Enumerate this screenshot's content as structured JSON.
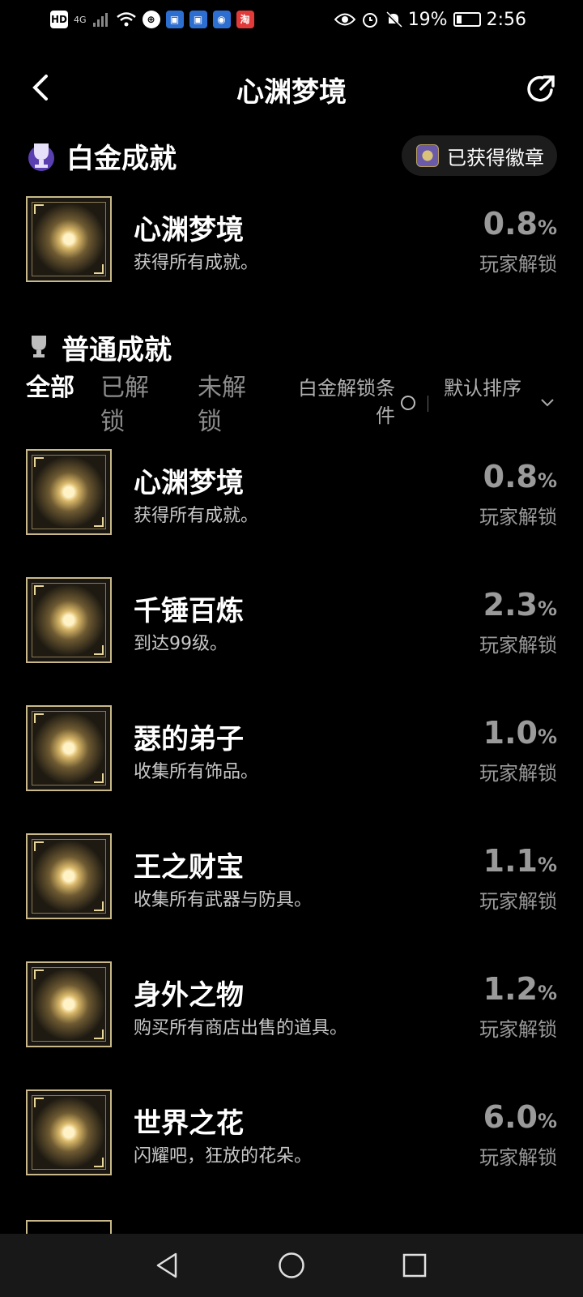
{
  "status_bar": {
    "hd": "HD",
    "network": "4G",
    "battery": "19%",
    "time": "2:56",
    "app_chip_taobao": "淘"
  },
  "header": {
    "title": "心渊梦境"
  },
  "platinum": {
    "title": "白金成就",
    "badge_label": "已获得徽章",
    "item": {
      "name": "心渊梦境",
      "desc": "获得所有成就。",
      "pct": "0.8",
      "unit": "%",
      "unlock": "玩家解锁"
    }
  },
  "normal": {
    "title": "普通成就"
  },
  "filters": {
    "tab_all": "全部",
    "tab_unlocked": "已解锁",
    "tab_locked": "未解锁",
    "platinum_condition": "白金解锁条件",
    "sort": "默认排序"
  },
  "achievements": [
    {
      "name": "心渊梦境",
      "desc": "获得所有成就。",
      "pct": "0.8",
      "unit": "%",
      "unlock": "玩家解锁",
      "icon": "dream-crest-icon"
    },
    {
      "name": "千锤百炼",
      "desc": "到达99级。",
      "pct": "2.3",
      "unit": "%",
      "unlock": "玩家解锁",
      "icon": "infinity-icon"
    },
    {
      "name": "瑟的弟子",
      "desc": "收集所有饰品。",
      "pct": "1.0",
      "unit": "%",
      "unlock": "玩家解锁",
      "icon": "creature-icon"
    },
    {
      "name": "王之财宝",
      "desc": "收集所有武器与防具。",
      "pct": "1.1",
      "unit": "%",
      "unlock": "玩家解锁",
      "icon": "armor-icon"
    },
    {
      "name": "身外之物",
      "desc": "购买所有商店出售的道具。",
      "pct": "1.2",
      "unit": "%",
      "unlock": "玩家解锁",
      "icon": "goods-icon"
    },
    {
      "name": "世界之花",
      "desc": "闪耀吧，狂放的花朵。",
      "pct": "6.0",
      "unit": "%",
      "unlock": "玩家解锁",
      "icon": "flower-icon"
    }
  ],
  "colors": {
    "background": "#000000",
    "percent_gray": "#9a9a9a",
    "icon_gold": "#c9b98a"
  }
}
